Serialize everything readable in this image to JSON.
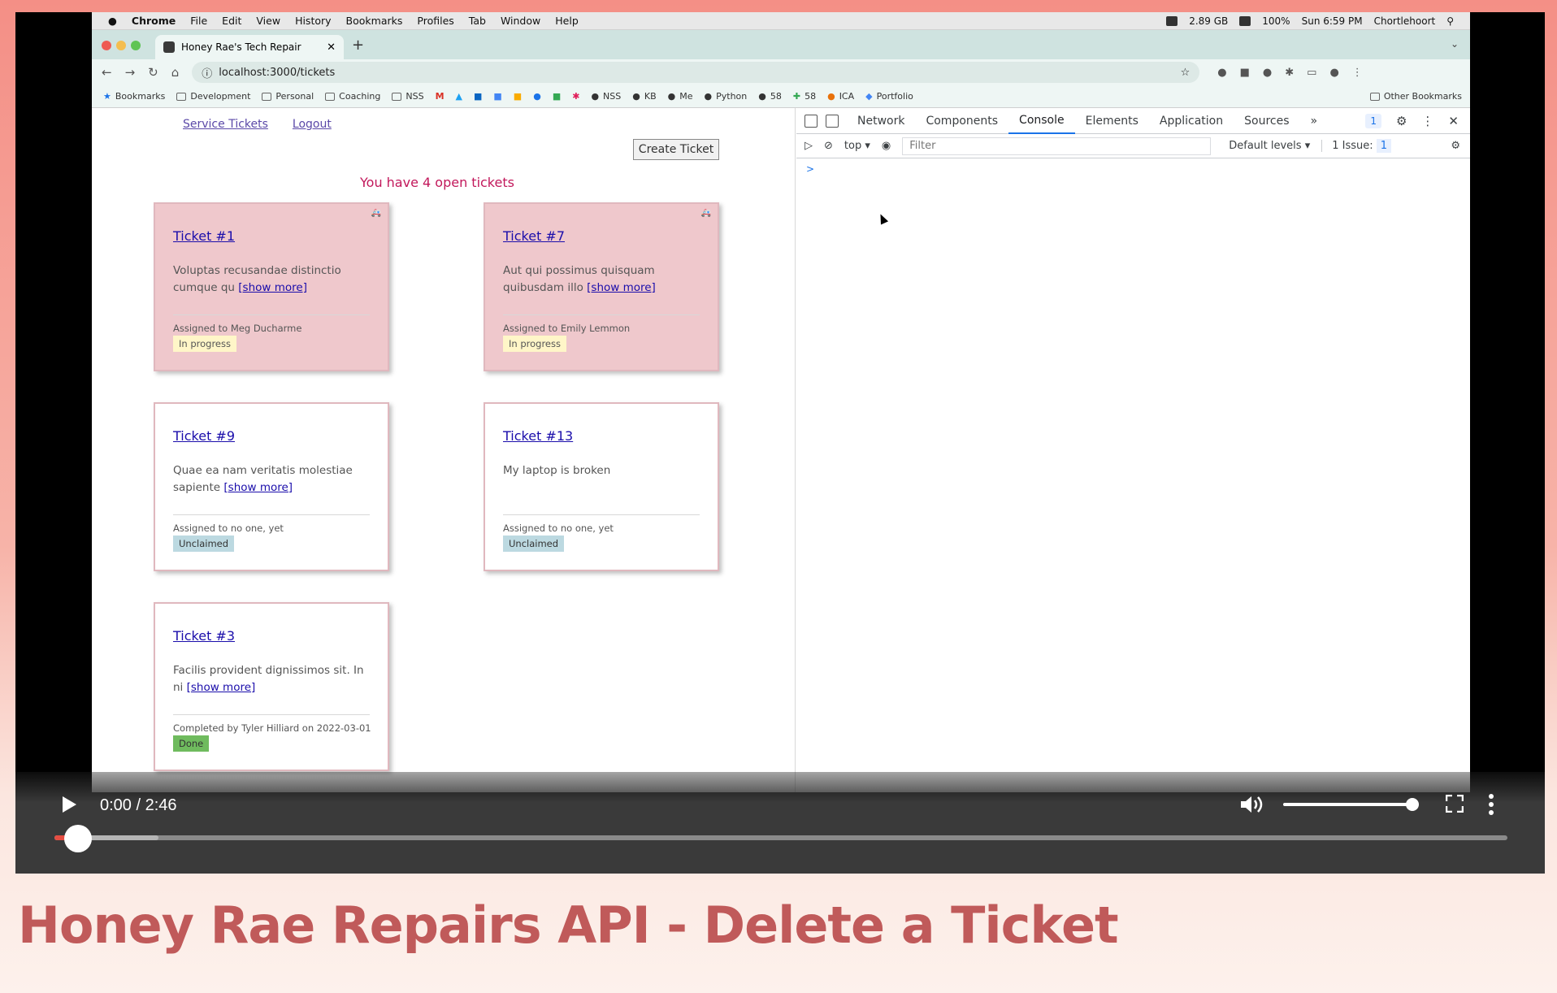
{
  "menubar": {
    "apple": "",
    "app": "Chrome",
    "items": [
      "File",
      "Edit",
      "View",
      "History",
      "Bookmarks",
      "Profiles",
      "Tab",
      "Window",
      "Help"
    ],
    "storage": "2.89 GB",
    "battery": "100%",
    "clock": "Sun 6:59 PM",
    "user": "Chortlehoort"
  },
  "browser": {
    "tab_title": "Honey Rae's Tech Repair",
    "url": "localhost:3000/tickets",
    "bookmarks": [
      "Bookmarks",
      "Development",
      "Personal",
      "Coaching",
      "NSS",
      "NSS",
      "KB",
      "Me",
      "Python",
      "58",
      "58",
      "ICA",
      "Portfolio"
    ],
    "other_bookmarks": "Other Bookmarks"
  },
  "app": {
    "nav": [
      "Service Tickets",
      "Logout"
    ],
    "create_button": "Create Ticket",
    "open_count": "You have 4 open tickets",
    "show_more": "[show more]",
    "tickets": [
      {
        "title": "Ticket #1",
        "desc": "Voluptas recusandae distinctio cumque qu",
        "assigned": "Assigned to Meg Ducharme",
        "status": "In progress",
        "emergency": true
      },
      {
        "title": "Ticket #7",
        "desc": "Aut qui possimus quisquam quibusdam illo",
        "assigned": "Assigned to Emily Lemmon",
        "status": "In progress",
        "emergency": true
      },
      {
        "title": "Ticket #9",
        "desc": "Quae ea nam veritatis molestiae sapiente",
        "assigned": "Assigned to no one, yet",
        "status": "Unclaimed",
        "emergency": false
      },
      {
        "title": "Ticket #13",
        "desc": "My laptop is broken",
        "assigned": "Assigned to no one, yet",
        "status": "Unclaimed",
        "emergency": false
      },
      {
        "title": "Ticket #3",
        "desc": "Facilis provident dignissimos sit. In ni",
        "assigned": "Completed by Tyler Hilliard on 2022-03-01",
        "status": "Done",
        "emergency": false
      }
    ]
  },
  "devtools": {
    "tabs": [
      "Network",
      "Components",
      "Console",
      "Elements",
      "Application",
      "Sources"
    ],
    "active_tab": "Console",
    "more": "»",
    "issues_badge": "1",
    "context": "top",
    "filter_placeholder": "Filter",
    "levels": "Default levels",
    "issue_label": "1 Issue:",
    "issue_count": "1",
    "prompt": ">"
  },
  "player": {
    "time": "0:00 / 2:46",
    "progress": 0.0,
    "volume": 1.0
  },
  "caption": "Honey Rae Repairs API - Delete a Ticket",
  "colors": {
    "accent": "#c05a5a",
    "ticket_emergency": "#efc8cc",
    "badge_progress": "#fff6c8",
    "badge_unclaimed": "#bcd9e1",
    "badge_done": "#6fbb5e"
  }
}
